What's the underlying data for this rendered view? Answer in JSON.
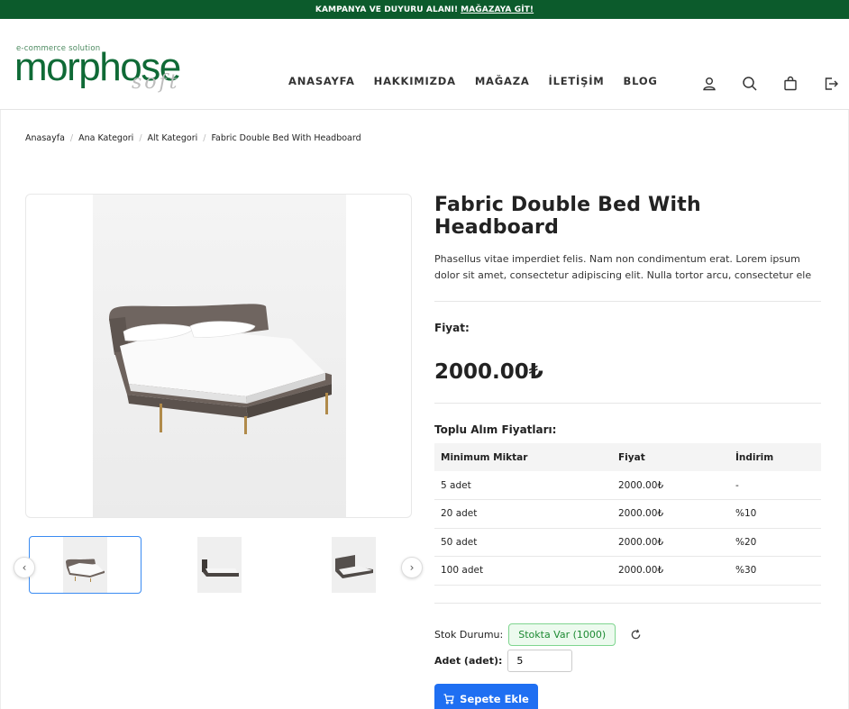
{
  "announcement": {
    "text": "KAMPANYA VE DUYURU ALANI!",
    "link": "MAĞAZAYA GİT!"
  },
  "logo": {
    "tagline": "e-commerce solution",
    "main": "morphose",
    "soft": "soft"
  },
  "nav": [
    "ANASAYFA",
    "HAKKIMIZDA",
    "MAĞAZA",
    "İLETİŞİM",
    "BLOG"
  ],
  "header_icons": [
    "user-icon",
    "search-icon",
    "shopping-bag-icon",
    "logout-icon"
  ],
  "breadcrumb": [
    "Anasayfa",
    "Ana Kategori",
    "Alt Kategori",
    "Fabric Double Bed With Headboard"
  ],
  "product": {
    "title": "Fabric Double Bed With Headboard",
    "description": "Phasellus vitae imperdiet felis. Nam non condimentum erat. Lorem ipsum dolor sit amet, consectetur adipiscing elit. Nulla tortor arcu, consectetur ele",
    "price_label": "Fiyat:",
    "price": "2000.00₺"
  },
  "bulk": {
    "label": "Toplu Alım Fiyatları:",
    "headers": [
      "Minimum Miktar",
      "Fiyat",
      "İndirim"
    ],
    "rows": [
      [
        "5 adet",
        "2000.00₺",
        "-"
      ],
      [
        "20 adet",
        "2000.00₺",
        "%10"
      ],
      [
        "50 adet",
        "2000.00₺",
        "%20"
      ],
      [
        "100 adet",
        "2000.00₺",
        "%30"
      ]
    ]
  },
  "stock": {
    "label": "Stok Durumu:",
    "value": "Stokta Var (1000)"
  },
  "quantity": {
    "label": "Adet (adet):",
    "value": "5"
  },
  "cart_button": "Sepete Ekle",
  "colors": {
    "brand_green": "#0c5b2c",
    "primary_blue": "#1f6ff2",
    "stock_green": "#1d8a33"
  }
}
